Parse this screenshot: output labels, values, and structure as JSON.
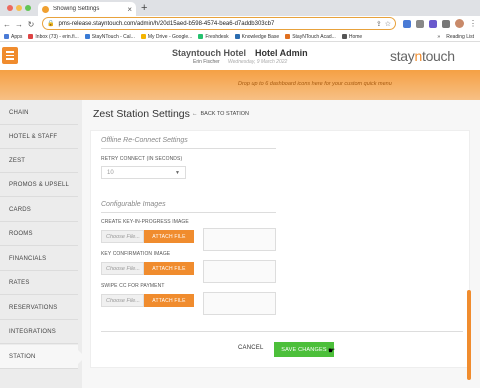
{
  "browser": {
    "tab_title": "Showing Settings",
    "url": "pms-release.stayntouch.com/admin/h/20d15aed-b598-4574-bea6-d7addb303cb7",
    "bookmarks": [
      "Apps",
      "Inbox (73) - erin.fi...",
      "StayNTouch - Cal...",
      "My Drive - Google...",
      "Freshdesk",
      "Knowledge Base",
      "StayNTouch Acad...",
      "Home"
    ],
    "reading_list": "Reading List",
    "colors": {
      "close": "#ed6a5e",
      "min": "#f5bf4f",
      "max": "#61c554"
    }
  },
  "header": {
    "hotel": "Stayntouch Hotel",
    "admin": "Hotel Admin",
    "user": "Erin Fischer",
    "date": "Wednesday, 9 March 2022",
    "logo_a": "stay",
    "logo_n": "n",
    "logo_b": "touch",
    "banner_text": "Drop up to 6 dashboard icons here for your custom quick menu"
  },
  "sidebar": {
    "items": [
      "CHAIN",
      "HOTEL & STAFF",
      "ZEST",
      "PROMOS & UPSELL",
      "CARDS",
      "ROOMS",
      "FINANCIALS",
      "RATES",
      "RESERVATIONS",
      "INTEGRATIONS",
      "STATION"
    ],
    "active": "STATION"
  },
  "page": {
    "title": "Zest Station Settings",
    "back_label": "BACK TO STATION",
    "offline_heading": "Offline Re-Connect Settings",
    "retry_label": "RETRY CONNECT (IN SECONDS)",
    "retry_value": "10",
    "images_heading": "Configurable Images",
    "images": [
      {
        "label": "CREATE KEY-IN-PROGRESS IMAGE",
        "placeholder": "Choose File...",
        "button": "ATTACH FILE"
      },
      {
        "label": "KEY CONFIRMATION IMAGE",
        "placeholder": "Choose File...",
        "button": "ATTACH FILE"
      },
      {
        "label": "SWIPE CC FOR PAYMENT",
        "placeholder": "Choose File...",
        "button": "ATTACH FILE"
      }
    ],
    "cancel": "CANCEL",
    "save": "SAVE CHANGES"
  },
  "colors": {
    "accent": "#f08c2e",
    "save": "#4cbf3a"
  }
}
